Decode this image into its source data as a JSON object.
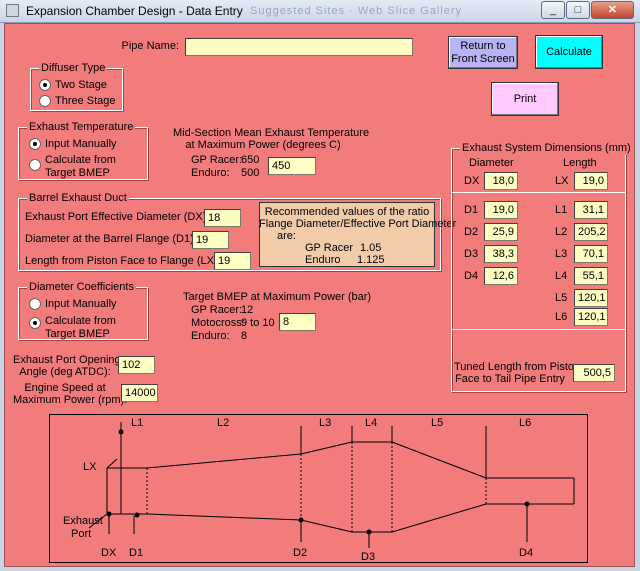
{
  "window": {
    "title": "Expansion Chamber Design - Data Entry",
    "ghost_text": "Suggested Sites  ·  Web Slice Gallery",
    "buttons": {
      "minimize": "_",
      "maximize": "□",
      "close": "✕"
    }
  },
  "pipe_name": {
    "label": "Pipe Name:",
    "value": ""
  },
  "buttons": {
    "return_label": "Return to Front Screen",
    "calculate_label": "Calculate",
    "print_label": "Print"
  },
  "colors": {
    "form_bg": "#f17c7b",
    "field_bg": "#ffffc4",
    "return_btn": "#b7b3f4",
    "calculate_btn": "#00ffff",
    "print_btn": "#ffc8ff"
  },
  "diffuser": {
    "title": "Diffuser Type",
    "options": [
      "Two Stage",
      "Three Stage"
    ],
    "selected": "Two Stage"
  },
  "exhaust_temp": {
    "title": "Exhaust Temperature",
    "options": [
      "Input Manually",
      "Calculate from Target BMEP"
    ],
    "selected": "Input Manually",
    "heading_line1": "Mid-Section Mean Exhaust Temperature",
    "heading_line2": "at Maximum Power (degrees C)",
    "gp_label": "GP Racer:",
    "gp_value": "650",
    "enduro_label": "Enduro:",
    "enduro_value": "500",
    "input_value": "450"
  },
  "barrel": {
    "title": "Barrel Exhaust Duct",
    "port_dia_label": "Exhaust Port Effective Diameter (DX) (mm):",
    "port_dia_value": "18",
    "flange_dia_label": "Diameter at the Barrel Flange (D1) (mm):",
    "flange_dia_value": "19",
    "length_label": "Length from Piston Face to Flange (LX) (mm):",
    "length_value": "19",
    "recommend_line1": "Recommended values of the ratio",
    "recommend_line2": "Flange Diameter/Effective Port Diameter",
    "recommend_are": "are:",
    "recommend_gp_label": "GP Racer",
    "recommend_gp_value": "1.05",
    "recommend_enduro_label": "Enduro",
    "recommend_enduro_value": "1.125"
  },
  "diameter_coeff": {
    "title": "Diameter Coefficients",
    "options": [
      "Input Manually",
      "Calculate from Target BMEP"
    ],
    "selected": "Calculate from Target BMEP",
    "heading": "Target BMEP at Maximum Power (bar)",
    "gp_label": "GP Racer:",
    "gp_value": "12",
    "moto_label": "Motocross:",
    "moto_value": "9 to 10",
    "enduro_label": "Enduro:",
    "enduro_value": "8",
    "input_value": "8"
  },
  "port_opening": {
    "label_line1": "Exhaust Port Opening",
    "label_line2": "Angle (deg ATDC):",
    "value": "102"
  },
  "engine_speed": {
    "label_line1": "Engine Speed at",
    "label_line2": "Maximum Power (rpm):",
    "value": "14000"
  },
  "dimensions": {
    "title": "Exhaust System Dimensions (mm)",
    "diameter_header": "Diameter",
    "length_header": "Length",
    "dx_label": "DX",
    "dx_value": "18,0",
    "lx_label": "LX",
    "lx_value": "19,0",
    "diameters": [
      {
        "label": "D1",
        "value": "19,0"
      },
      {
        "label": "D2",
        "value": "25,9"
      },
      {
        "label": "D3",
        "value": "38,3"
      },
      {
        "label": "D4",
        "value": "12,6"
      }
    ],
    "lengths": [
      {
        "label": "L1",
        "value": "31,1"
      },
      {
        "label": "L2",
        "value": "205,2"
      },
      {
        "label": "L3",
        "value": "70,1"
      },
      {
        "label": "L4",
        "value": "55,1"
      },
      {
        "label": "L5",
        "value": "120,1"
      },
      {
        "label": "L6",
        "value": "120,1"
      }
    ],
    "tuned_label_line1": "Tuned Length from Piston",
    "tuned_label_line2": "Face to Tail Pipe Entry",
    "tuned_value": "500,5"
  },
  "diagram": {
    "top_labels": [
      "L1",
      "L2",
      "L3",
      "L4",
      "L5",
      "L6"
    ],
    "bottom_labels": [
      "DX",
      "D1",
      "D2",
      "D3",
      "D4"
    ],
    "lx_label": "LX",
    "exhaust_label_line1": "Exhaust",
    "exhaust_label_line2": "Port"
  }
}
